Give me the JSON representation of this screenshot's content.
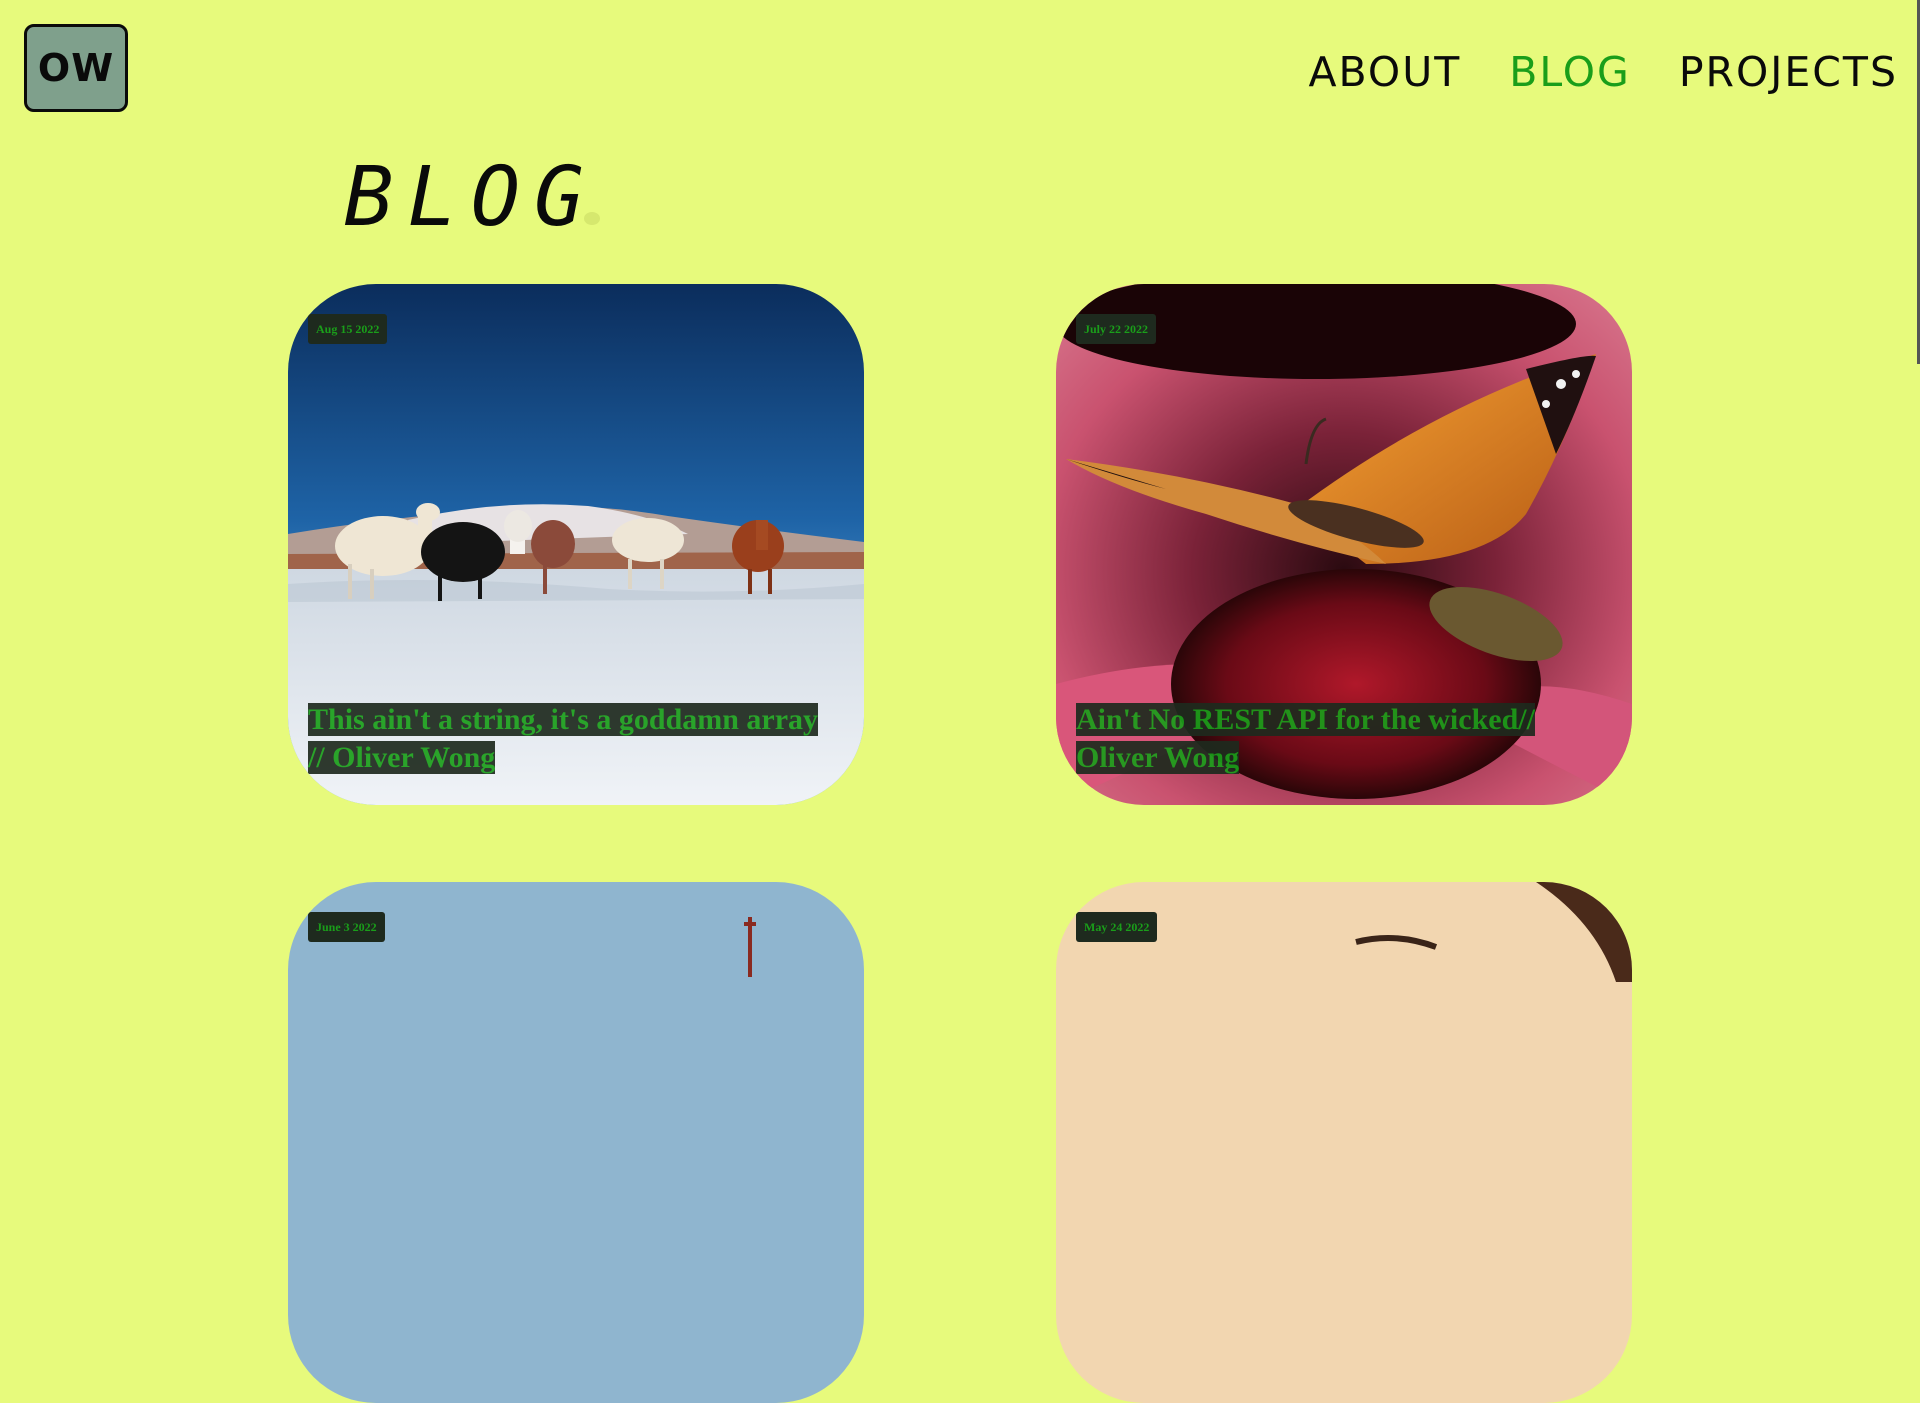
{
  "logo": {
    "text": "OW"
  },
  "nav": {
    "items": [
      {
        "label": "ABOUT"
      },
      {
        "label": "BLOG"
      },
      {
        "label": "PROJECTS"
      }
    ]
  },
  "page": {
    "title": "BLOG"
  },
  "posts": [
    {
      "date": "Aug 15 2022",
      "title": "This ain't a string, it's a goddamn array // Oliver Wong",
      "image": "llamas-in-snowy-desert"
    },
    {
      "date": "July 22 2022",
      "title": "Ain't No REST API for the wicked// Oliver Wong",
      "image": "butterfly-on-coneflower"
    },
    {
      "date": "June 3 2022",
      "title": "",
      "image": "blue-sky-with-tower"
    },
    {
      "date": "May 24 2022",
      "title": "",
      "image": "portrait-warm-tones"
    }
  ],
  "colors": {
    "background": "#e7fa7c",
    "accent": "#1a9e1a",
    "logo_fill": "#7fa08c",
    "badge_bg": "#1e2a1e"
  }
}
